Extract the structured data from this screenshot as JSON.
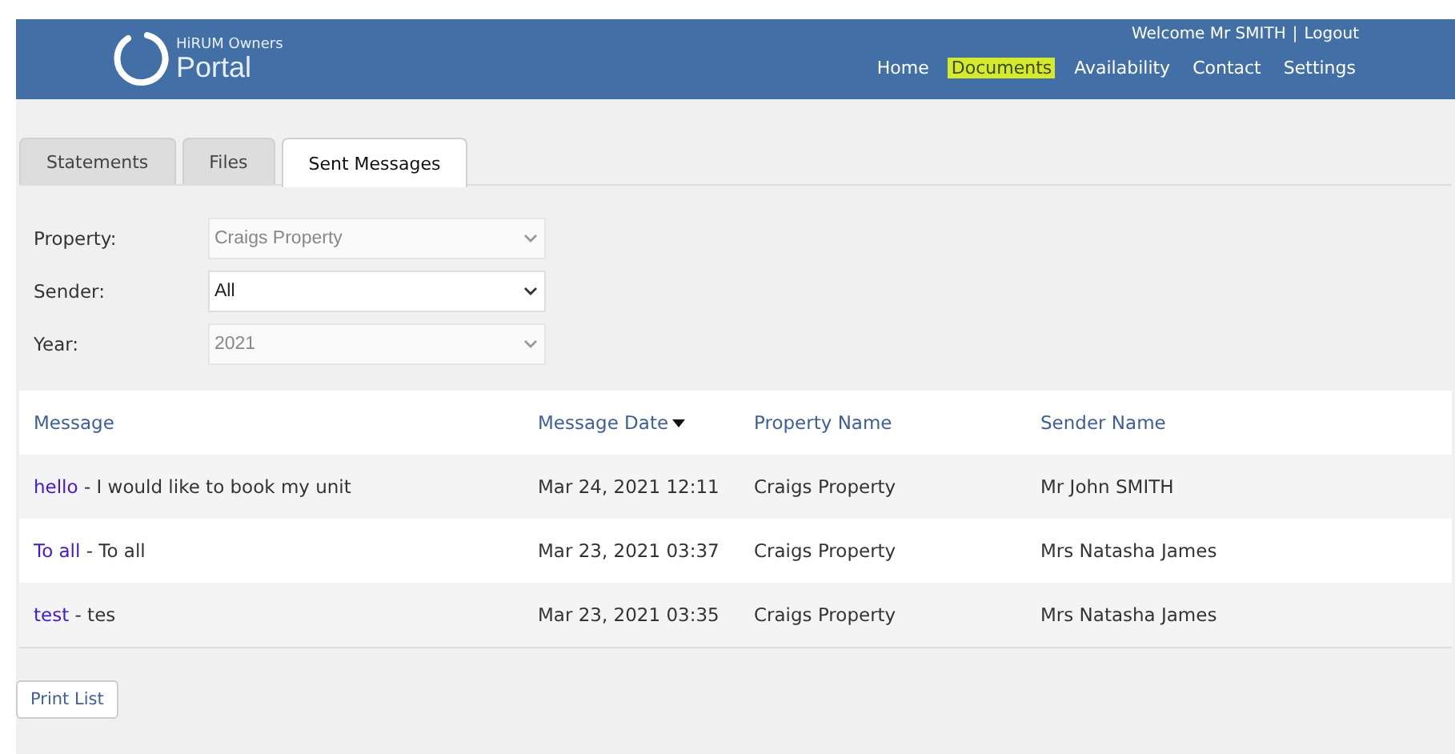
{
  "header": {
    "logo_small": "HiRUM Owners",
    "logo_large": "Portal",
    "welcome": "Welcome Mr SMITH",
    "separator": "|",
    "logout": "Logout",
    "nav": [
      {
        "label": "Home",
        "selected": false
      },
      {
        "label": "Documents",
        "selected": true
      },
      {
        "label": "Availability",
        "selected": false
      },
      {
        "label": "Contact",
        "selected": false
      },
      {
        "label": "Settings",
        "selected": false
      }
    ]
  },
  "tabs": [
    {
      "label": "Statements",
      "selected": false
    },
    {
      "label": "Files",
      "selected": false
    },
    {
      "label": "Sent Messages",
      "selected": true
    }
  ],
  "filters": [
    {
      "label": "Property:",
      "value": "Craigs Property",
      "disabled": true
    },
    {
      "label": "Sender:",
      "value": "All",
      "disabled": false
    },
    {
      "label": "Year:",
      "value": "2021",
      "disabled": true
    }
  ],
  "table": {
    "columns": [
      {
        "label": "Message",
        "sorted": false
      },
      {
        "label": "Message Date",
        "sorted": true
      },
      {
        "label": "Property Name",
        "sorted": false
      },
      {
        "label": "Sender Name",
        "sorted": false
      }
    ],
    "rows": [
      {
        "subject": "hello",
        "body": "- I would like to book my unit",
        "date": "Mar 24, 2021 12:11",
        "property": "Craigs Property",
        "sender": "Mr John SMITH"
      },
      {
        "subject": "To all",
        "body": "- To all",
        "date": "Mar 23, 2021 03:37",
        "property": "Craigs Property",
        "sender": "Mrs Natasha James"
      },
      {
        "subject": "test",
        "body": "- tes",
        "date": "Mar 23, 2021 03:35",
        "property": "Craigs Property",
        "sender": "Mrs Natasha James"
      }
    ]
  },
  "print_button": "Print List"
}
